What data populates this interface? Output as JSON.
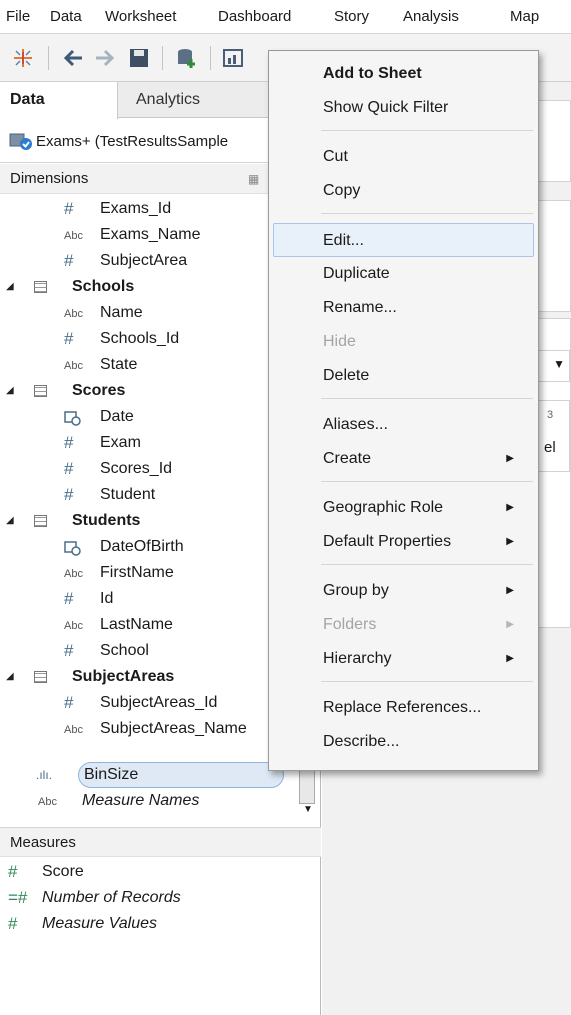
{
  "menubar": {
    "items": [
      "File",
      "Data",
      "Worksheet",
      "Dashboard",
      "Story",
      "Analysis",
      "Map"
    ]
  },
  "toolbar": {
    "icons": [
      "tableau-logo-icon",
      "back-arrow-icon",
      "forward-arrow-icon",
      "save-icon",
      "add-datasource-icon",
      "new-worksheet-icon"
    ]
  },
  "panel": {
    "tabs": {
      "data": "Data",
      "analytics": "Analytics"
    },
    "datasource": "Exams+ (TestResultsSample",
    "dimensions_header": "Dimensions",
    "measures_header": "Measures"
  },
  "dimensions": [
    {
      "label": "Exams_Id",
      "type": "number"
    },
    {
      "label": "Exams_Name",
      "type": "string"
    },
    {
      "label": "SubjectArea",
      "type": "number"
    },
    {
      "label": "Schools",
      "type": "table"
    },
    {
      "label": "Name",
      "type": "string"
    },
    {
      "label": "Schools_Id",
      "type": "number"
    },
    {
      "label": "State",
      "type": "string"
    },
    {
      "label": "Scores",
      "type": "table"
    },
    {
      "label": "Date",
      "type": "date"
    },
    {
      "label": "Exam",
      "type": "number"
    },
    {
      "label": "Scores_Id",
      "type": "number"
    },
    {
      "label": "Student",
      "type": "number"
    },
    {
      "label": "Students",
      "type": "table"
    },
    {
      "label": "DateOfBirth",
      "type": "date"
    },
    {
      "label": "FirstName",
      "type": "string"
    },
    {
      "label": "Id",
      "type": "number"
    },
    {
      "label": "LastName",
      "type": "string"
    },
    {
      "label": "School",
      "type": "number"
    },
    {
      "label": "SubjectAreas",
      "type": "table"
    },
    {
      "label": "SubjectAreas_Id",
      "type": "number"
    },
    {
      "label": "SubjectAreas_Name",
      "type": "string"
    },
    {
      "label": "BinSize",
      "type": "bin",
      "selected": true
    },
    {
      "label": "Measure Names",
      "type": "string"
    }
  ],
  "measures": [
    {
      "label": "Score",
      "type": "number"
    },
    {
      "label": "Number of Records",
      "type": "calc"
    },
    {
      "label": "Measure Values",
      "type": "number"
    }
  ],
  "icon_glyphs": {
    "number": "#",
    "string": "Abc",
    "date": "date-icon",
    "bin": ".ılı.",
    "calc": "=#"
  },
  "context_menu": {
    "items": [
      {
        "label": "Add to Sheet",
        "bold": true
      },
      {
        "label": "Show Quick Filter"
      },
      {
        "label": "Cut"
      },
      {
        "label": "Copy"
      },
      {
        "label": "Edit...",
        "highlighted": true
      },
      {
        "label": "Duplicate"
      },
      {
        "label": "Rename..."
      },
      {
        "label": "Hide",
        "disabled": true
      },
      {
        "label": "Delete"
      },
      {
        "label": "Aliases..."
      },
      {
        "label": "Create",
        "submenu": true
      },
      {
        "label": "Geographic Role",
        "submenu": true
      },
      {
        "label": "Default Properties",
        "submenu": true
      },
      {
        "label": "Group by",
        "submenu": true
      },
      {
        "label": "Folders",
        "submenu": true,
        "disabled": true
      },
      {
        "label": "Hierarchy",
        "submenu": true
      },
      {
        "label": "Replace References..."
      },
      {
        "label": "Describe..."
      }
    ]
  },
  "right_pane": {
    "partial_text_1": "el",
    "partial_text_2": "3"
  },
  "colors": {
    "accent": "#4a6f8a",
    "selection": "#dfe9f6",
    "menu_bg": "#f5f5f5"
  }
}
